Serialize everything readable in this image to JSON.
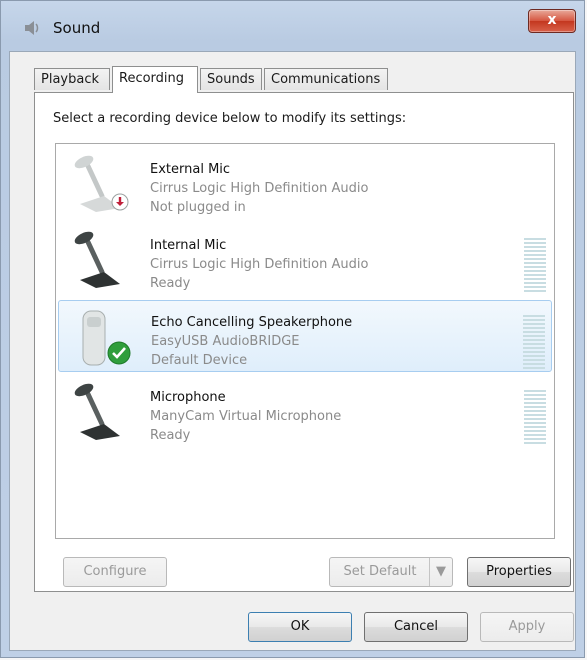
{
  "window": {
    "title": "Sound",
    "close_glyph": "x"
  },
  "tabs": [
    {
      "label": "Playback"
    },
    {
      "label": "Recording"
    },
    {
      "label": "Sounds"
    },
    {
      "label": "Communications"
    }
  ],
  "recording": {
    "instruction": "Select a recording device below to modify its settings:",
    "devices": [
      {
        "name": "External Mic",
        "driver": "Cirrus Logic High Definition Audio",
        "status": "Not plugged in",
        "icon": "microphone-icon",
        "badge": "unplugged-badge-icon"
      },
      {
        "name": "Internal Mic",
        "driver": "Cirrus Logic High Definition Audio",
        "status": "Ready",
        "icon": "microphone-icon"
      },
      {
        "name": "Echo Cancelling Speakerphone",
        "driver": "EasyUSB AudioBRIDGE",
        "status": "Default Device",
        "icon": "speakerphone-icon",
        "badge": "default-check-icon"
      },
      {
        "name": "Microphone",
        "driver": "ManyCam Virtual Microphone",
        "status": "Ready",
        "icon": "microphone-icon"
      }
    ],
    "configure_label": "Configure",
    "set_default_label": "Set Default",
    "properties_label": "Properties"
  },
  "footer": {
    "ok_label": "OK",
    "cancel_label": "Cancel",
    "apply_label": "Apply"
  }
}
